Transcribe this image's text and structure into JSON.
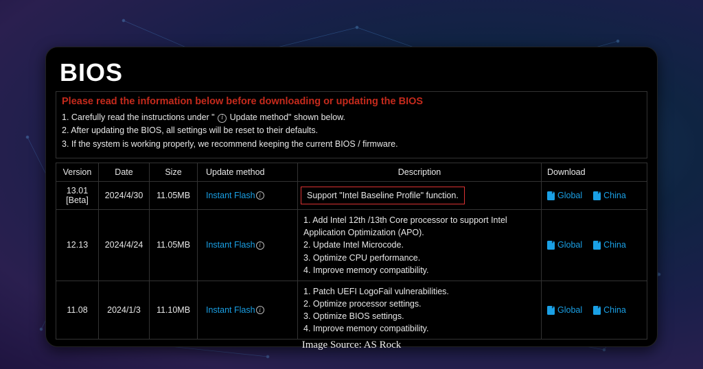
{
  "page": {
    "title": "BIOS"
  },
  "warning": {
    "title": "Please read the information below before downloading or updating the BIOS",
    "line1_pre": "1. Carefully read the instructions under \" ",
    "line1_post": " Update method\" shown below.",
    "line2": "2. After updating the BIOS, all settings will be reset to their defaults.",
    "line3": "3. If the system is working properly, we recommend keeping the current BIOS / firmware."
  },
  "table": {
    "headers": {
      "version": "Version",
      "date": "Date",
      "size": "Size",
      "method": "Update method",
      "description": "Description",
      "download": "Download"
    },
    "method_label": "Instant Flash",
    "downloads": {
      "global": "Global",
      "china": "China"
    },
    "rows": [
      {
        "version": "13.01 [Beta]",
        "date": "2024/4/30",
        "size": "11.05MB",
        "description": "Support \"Intel Baseline Profile\" function.",
        "highlight": true
      },
      {
        "version": "12.13",
        "date": "2024/4/24",
        "size": "11.05MB",
        "description": "1. Add Intel 12th /13th Core processor to support Intel Application Optimization (APO).\n2. Update Intel Microcode.\n3. Optimize CPU performance.\n4. Improve memory compatibility.",
        "highlight": false
      },
      {
        "version": "11.08",
        "date": "2024/1/3",
        "size": "11.10MB",
        "description": "1. Patch UEFI LogoFail vulnerabilities.\n2. Optimize processor settings.\n3. Optimize BIOS settings.\n4. Improve memory compatibility.",
        "highlight": false
      }
    ]
  },
  "caption": "Image Source: AS Rock"
}
